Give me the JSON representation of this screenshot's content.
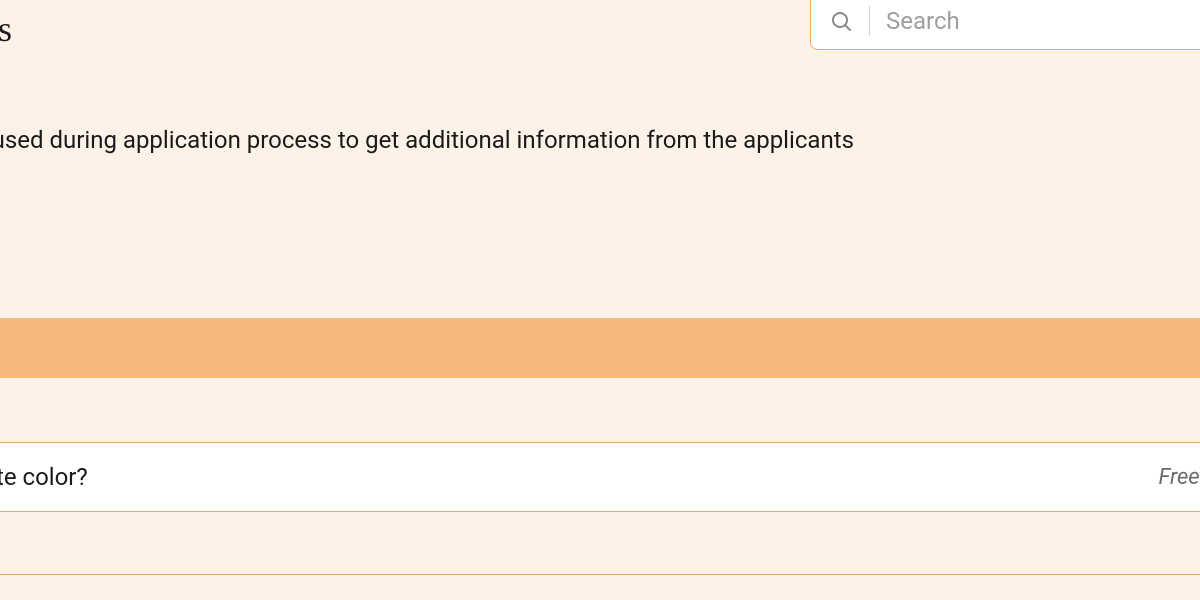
{
  "header": {
    "title_fragment": "ions",
    "search": {
      "placeholder": "Search",
      "value": ""
    }
  },
  "description": {
    "text_fragment": "are used during application process to get additional information from the applicants"
  },
  "question_list": {
    "items": [
      {
        "text_fragment": "avorite color?",
        "type_fragment": "Free t"
      }
    ]
  }
}
